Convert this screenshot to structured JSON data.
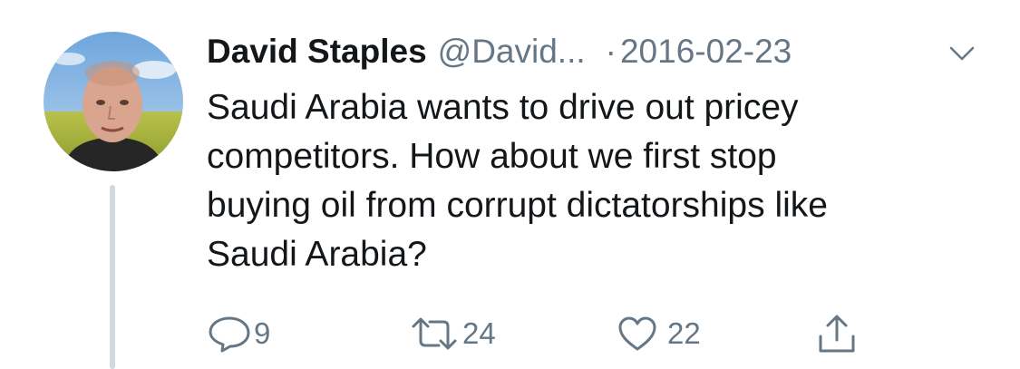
{
  "tweet": {
    "display_name": "David Staples",
    "handle": "@David...",
    "separator": "·",
    "date": "2016-02-23",
    "text": "Saudi Arabia wants to drive out pricey\ncompetitors. How about we first stop\nbuying oil from corrupt dictatorships like\nSaudi Arabia?"
  },
  "actions": {
    "reply": {
      "icon": "reply-icon",
      "count": "9"
    },
    "retweet": {
      "icon": "retweet-icon",
      "count": "24"
    },
    "like": {
      "icon": "heart-icon",
      "count": "22"
    },
    "share": {
      "icon": "share-icon"
    }
  },
  "colors": {
    "text": "#14171a",
    "secondary": "#657786",
    "thread_line": "#cfd9de"
  }
}
